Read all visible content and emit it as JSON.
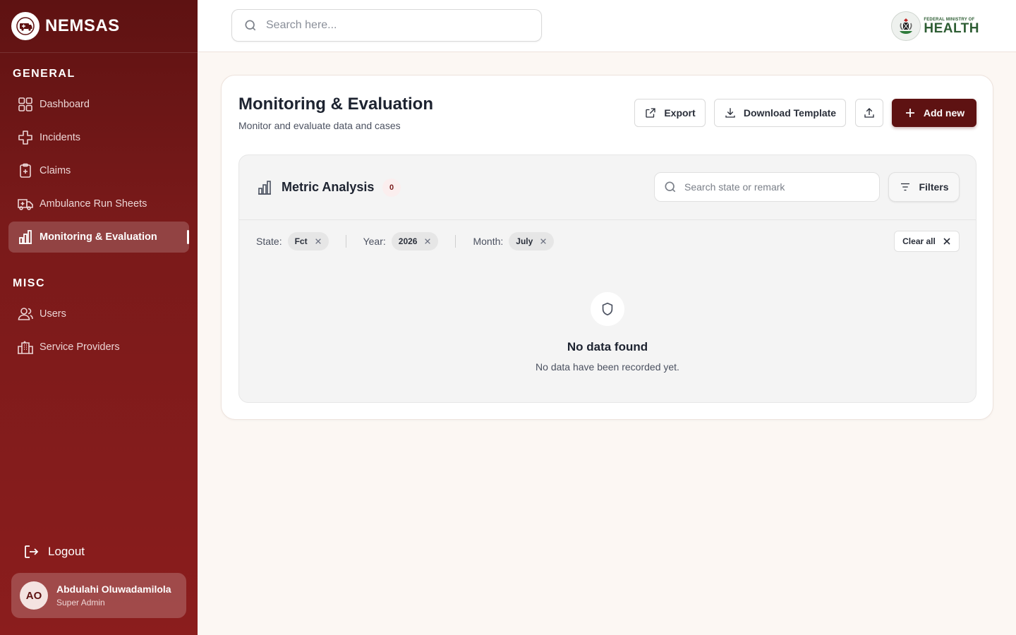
{
  "app": {
    "name": "NEMSAS"
  },
  "sidebar": {
    "sections": [
      {
        "label": "GENERAL"
      },
      {
        "label": "MISC"
      }
    ],
    "items": [
      {
        "label": "Dashboard",
        "icon": "grid-icon"
      },
      {
        "label": "Incidents",
        "icon": "cross-icon"
      },
      {
        "label": "Claims",
        "icon": "clipboard-plus-icon"
      },
      {
        "label": "Ambulance Run Sheets",
        "icon": "ambulance-icon"
      },
      {
        "label": "Monitoring & Evaluation",
        "icon": "bar-chart-icon",
        "active": true
      },
      {
        "label": "Users",
        "icon": "users-icon"
      },
      {
        "label": "Service Providers",
        "icon": "building-icon"
      }
    ],
    "logout_label": "Logout",
    "user": {
      "initials": "AO",
      "name": "Abdulahi Oluwadamilola",
      "role": "Super Admin"
    }
  },
  "header": {
    "search_placeholder": "Search here...",
    "ministry": {
      "small": "FEDERAL MINISTRY OF",
      "big": "HEALTH"
    }
  },
  "page": {
    "title": "Monitoring & Evaluation",
    "subtitle": "Monitor and evaluate data and cases",
    "actions": {
      "export": "Export",
      "download_template": "Download Template",
      "add_new": "Add new"
    }
  },
  "panel": {
    "title": "Metric Analysis",
    "count": "0",
    "search_placeholder": "Search state or remark",
    "filters_label": "Filters",
    "active_filters": [
      {
        "label": "State:",
        "value": "Fct"
      },
      {
        "label": "Year:",
        "value": "2026"
      },
      {
        "label": "Month:",
        "value": "July"
      }
    ],
    "clear_all": "Clear all",
    "empty": {
      "title": "No data found",
      "subtitle": "No data have been recorded yet."
    }
  },
  "colors": {
    "brand": "#5e1212",
    "sidebar_bottom": "#8b1d1d",
    "page_bg": "#fcf7f3",
    "ministry_green": "#2d5d33"
  }
}
